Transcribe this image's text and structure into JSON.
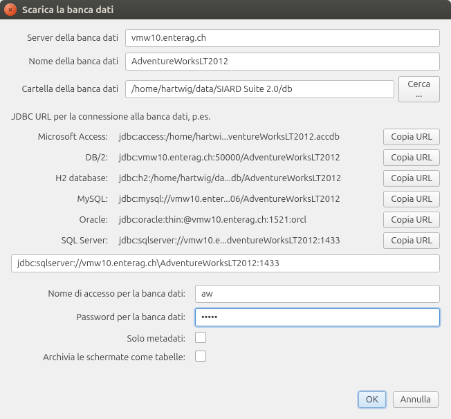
{
  "window": {
    "title": "Scarica la banca dati"
  },
  "fields": {
    "server_label": "Server della banca dati",
    "server_value": "vmw10.enterag.ch",
    "dbname_label": "Nome della banca dati",
    "dbname_value": "AdventureWorksLT2012",
    "folder_label": "Cartella della banca dati",
    "folder_value": "/home/hartwig/data/SIARD Suite 2.0/db",
    "browse_label": "Cerca ..."
  },
  "jdbc": {
    "heading": "JDBC URL per la connessione alla banca dati, p.es.",
    "copy_label": "Copia URL",
    "rows": [
      {
        "label": "Microsoft Access:",
        "url": "jdbc:access:/home/hartwi...ventureWorksLT2012.accdb"
      },
      {
        "label": "DB/2:",
        "url": "jdbc:vmw10.enterag.ch:50000/AdventureWorksLT2012"
      },
      {
        "label": "H2 database:",
        "url": "jdbc:h2:/home/hartwig/da...db/AdventureWorksLT2012"
      },
      {
        "label": "MySQL:",
        "url": "jdbc:mysql://vmw10.enter...06/AdventureWorksLT2012"
      },
      {
        "label": "Oracle:",
        "url": "jdbc:oracle:thin:@vmw10.enterag.ch:1521:orcl"
      },
      {
        "label": "SQL Server:",
        "url": "jdbc:sqlserver://vmw10.e...dventureWorksLT2012:1433"
      }
    ],
    "full_url": "jdbc:sqlserver://vmw10.enterag.ch\\AdventureWorksLT2012:1433"
  },
  "credentials": {
    "user_label": "Nome di accesso per la banca dati:",
    "user_value": "aw",
    "pass_label": "Password per la banca dati:",
    "pass_value": "•••••",
    "meta_label": "Solo metadati:",
    "views_label": "Archivia le schermate come tabelle:"
  },
  "footer": {
    "ok": "OK",
    "cancel": "Annulla"
  }
}
